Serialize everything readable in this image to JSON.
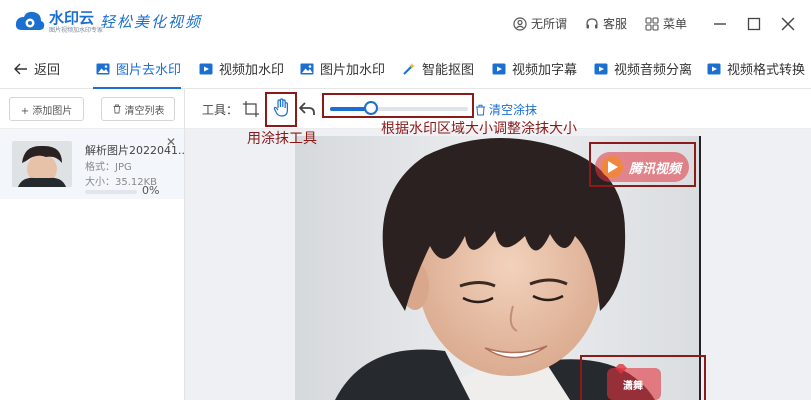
{
  "app": {
    "name": "水印云",
    "subtitle": "图片视频加水印专家",
    "slogan": "轻松美化视频"
  },
  "titlebar": {
    "links": [
      {
        "label": "无所谓",
        "icon": "user-icon"
      },
      {
        "label": "客服",
        "icon": "headset-icon"
      },
      {
        "label": "菜单",
        "icon": "grid-icon"
      }
    ]
  },
  "nav": {
    "back_label": "返回",
    "items": [
      {
        "label": "图片去水印",
        "icon": "image-icon",
        "active": true
      },
      {
        "label": "视频加水印",
        "icon": "video-icon"
      },
      {
        "label": "图片加水印",
        "icon": "image-icon"
      },
      {
        "label": "智能抠图",
        "icon": "magic-wand-icon"
      },
      {
        "label": "视频加字幕",
        "icon": "video-icon"
      },
      {
        "label": "视频音频分离",
        "icon": "video-icon"
      },
      {
        "label": "视频格式转换",
        "icon": "video-icon"
      }
    ]
  },
  "leftpanel": {
    "add_label": "+ 添加图片",
    "clear_label": "清空列表",
    "file": {
      "name": "解析图片2022041...",
      "format": "格式：JPG",
      "size": "大小：35.12KB",
      "progress_text": "0%",
      "progress": 0
    }
  },
  "toolbar": {
    "tools_label": "工具：",
    "clear_paint_label": "清空涂抹",
    "brush_size": 0.3
  },
  "annotations": {
    "brush_tool": "用涂抹工具",
    "slider_hint": "根据水印区域大小调整涂抹大小"
  },
  "preview": {
    "watermark_top": "腾讯视频",
    "watermark_bottom": "潇舞",
    "colors": {
      "hair": "#2a2120",
      "skin": "#e8c0a8",
      "jacket": "#26292d",
      "watermark": "#e2343f"
    }
  },
  "colors": {
    "accent": "#1a6fd1",
    "annotation": "#8b1a1a"
  }
}
